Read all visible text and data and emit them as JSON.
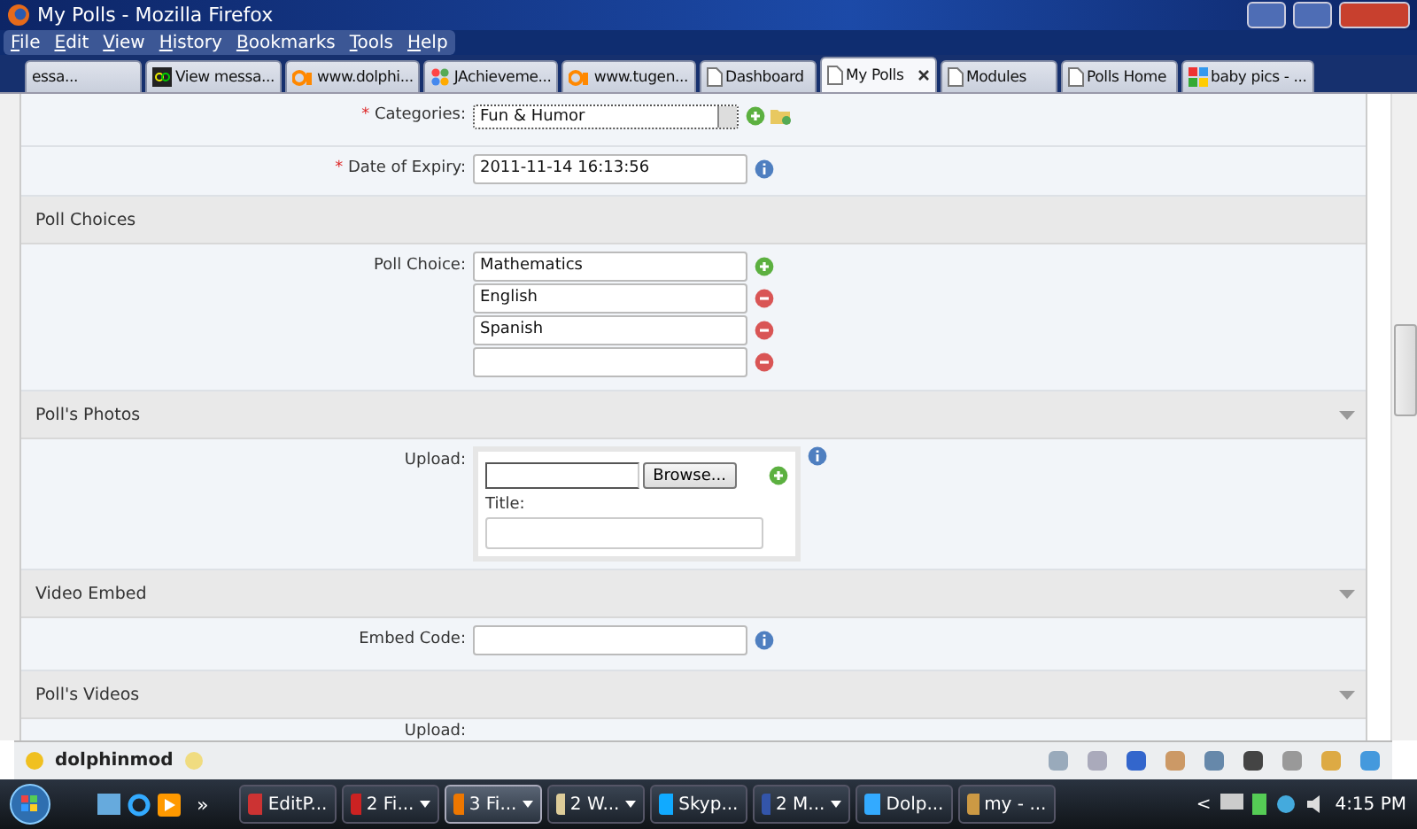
{
  "window": {
    "title": "My Polls - Mozilla Firefox"
  },
  "menu": [
    "File",
    "Edit",
    "View",
    "History",
    "Bookmarks",
    "Tools",
    "Help"
  ],
  "tabs": [
    {
      "label": "essa...",
      "selected": false
    },
    {
      "label": "View messa...",
      "selected": false
    },
    {
      "label": "www.dolphi...",
      "selected": false
    },
    {
      "label": "JAchieveme...",
      "selected": false
    },
    {
      "label": "www.tugen...",
      "selected": false
    },
    {
      "label": "Dashboard",
      "selected": false
    },
    {
      "label": "My Polls",
      "selected": true
    },
    {
      "label": "Modules",
      "selected": false
    },
    {
      "label": "Polls Home",
      "selected": false
    },
    {
      "label": "baby pics - ...",
      "selected": false
    }
  ],
  "top_fields": [
    {
      "kind": "select",
      "required_mark": "*",
      "label": "Categories:",
      "value": "Fun & Humor"
    },
    {
      "kind": "text",
      "required_mark": "*",
      "label": "Date of Expiry:",
      "value": "2011-11-14 16:13:56"
    }
  ],
  "sections": [
    {
      "title": "Poll Choices",
      "collapsible": false,
      "kind": "choices",
      "label": "Poll Choice:",
      "choices": [
        {
          "value": "Mathematics",
          "kind": "add"
        },
        {
          "value": "English",
          "kind": "remove"
        },
        {
          "value": "Spanish",
          "kind": "remove"
        },
        {
          "kind": "remove"
        }
      ]
    },
    {
      "title": "Poll's Photos",
      "collapsible": true,
      "kind": "upload",
      "label": "Upload:",
      "button": "Browse...",
      "title_label": "Title:"
    },
    {
      "title": "Video Embed",
      "collapsible": true,
      "kind": "embed",
      "label": "Embed Code:"
    },
    {
      "title": "Poll's Videos",
      "collapsible": true,
      "kind": "upload_partial",
      "label": "Upload:"
    }
  ],
  "dolphin_bar": {
    "user": "dolphinmod"
  },
  "taskbar": {
    "tasks": [
      {
        "label": "EditP...",
        "selected": false,
        "grouped": false
      },
      {
        "label": "2 Fi...",
        "selected": false,
        "grouped": true
      },
      {
        "label": "3 Fi...",
        "selected": true,
        "grouped": true
      },
      {
        "label": "2 W...",
        "selected": false,
        "grouped": true
      },
      {
        "label": "Skyp...",
        "selected": false,
        "grouped": false
      },
      {
        "label": "2 M...",
        "selected": false,
        "grouped": true
      },
      {
        "label": "Dolp...",
        "selected": false,
        "grouped": false
      },
      {
        "label": "my - ...",
        "selected": false,
        "grouped": false
      }
    ],
    "more": "»",
    "tray_toggle": "<",
    "clock": "4:15 PM"
  }
}
